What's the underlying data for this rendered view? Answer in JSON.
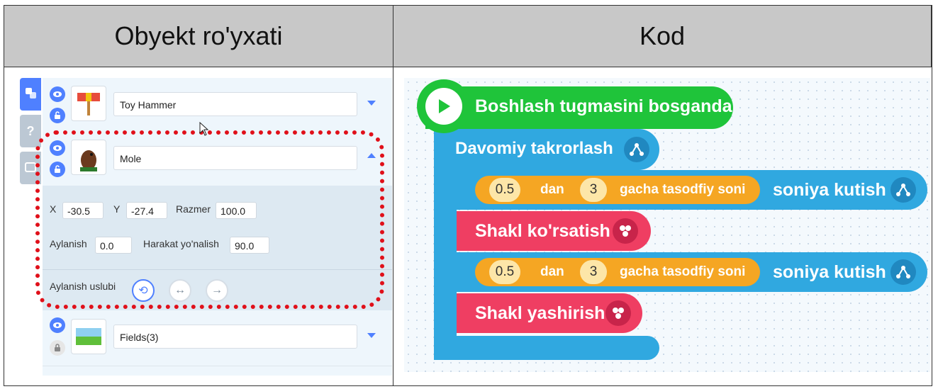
{
  "headers": {
    "left": "Obyekt ro'yxati",
    "right": "Kod"
  },
  "objects": [
    {
      "name": "Toy Hammer",
      "expanded": false,
      "icon": "toy-hammer"
    },
    {
      "name": "Mole",
      "expanded": true,
      "icon": "mole"
    },
    {
      "name": "Fields(3)",
      "expanded": false,
      "icon": "fields"
    }
  ],
  "props": {
    "x_label": "X",
    "x_value": "-30.5",
    "y_label": "Y",
    "y_value": "-27.4",
    "size_label": "Razmer",
    "size_value": "100.0",
    "rotation_label": "Aylanish",
    "rotation_value": "0.0",
    "direction_label": "Harakat yo'nalish",
    "direction_value": "90.0",
    "rotation_style_label": "Aylanish uslubi"
  },
  "code": {
    "start": "Boshlash tugmasini bosganda",
    "forever": "Davomiy takrorlash",
    "wait1": {
      "from": "0.5",
      "dan": "dan",
      "to": "3",
      "gacha": "gacha tasodfiy soni",
      "suffix": "soniya kutish"
    },
    "show": "Shakl ko'rsatish",
    "wait2": {
      "from": "0.5",
      "dan": "dan",
      "to": "3",
      "gacha": "gacha tasodfiy soni",
      "suffix": "soniya kutish"
    },
    "hide": "Shakl yashirish"
  },
  "colors": {
    "accent": "#4f80ff",
    "start": "#1fc43a",
    "flow": "#30a8e0",
    "looks": "#ef3e62",
    "calc": "#f5a623",
    "highlight": "#e0101a"
  }
}
